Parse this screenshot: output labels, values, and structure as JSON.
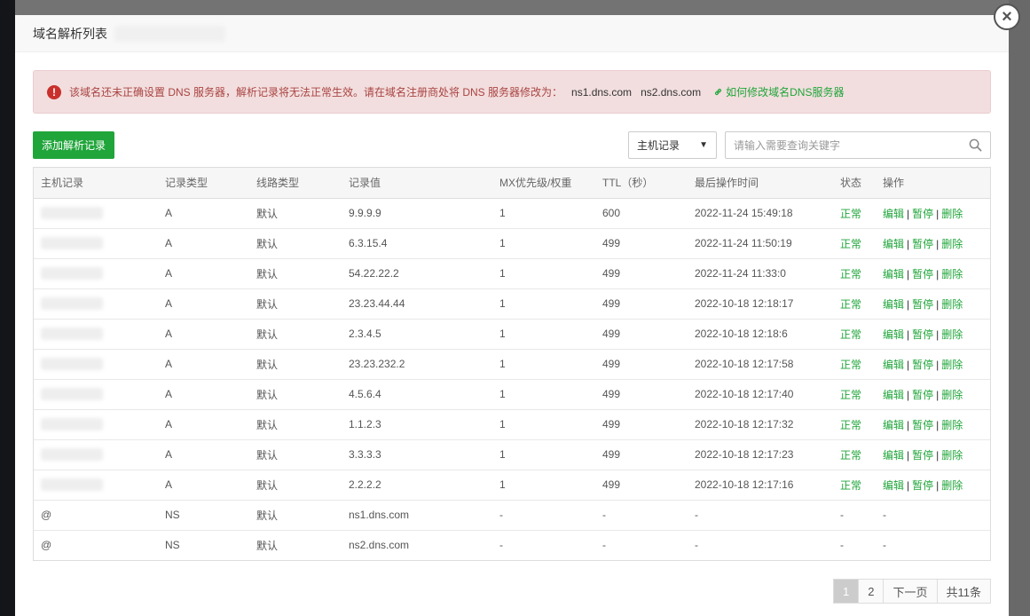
{
  "dialog": {
    "title": "域名解析列表"
  },
  "alert": {
    "message": "该域名还未正确设置 DNS 服务器，解析记录将无法正常生效。请在域名注册商处将 DNS 服务器修改为：",
    "ns1": "ns1.dns.com",
    "ns2": "ns2.dns.com",
    "link": "如何修改域名DNS服务器"
  },
  "toolbar": {
    "add_label": "添加解析记录",
    "select_value": "主机记录",
    "search_placeholder": "请输入需要查询关键字"
  },
  "table": {
    "headers": [
      "主机记录",
      "记录类型",
      "线路类型",
      "记录值",
      "MX优先级/权重",
      "TTL（秒）",
      "最后操作时间",
      "状态",
      "操作"
    ],
    "rows": [
      {
        "host": "",
        "type": "A",
        "line": "默认",
        "value": "9.9.9.9",
        "mx": "1",
        "ttl": "600",
        "time": "2022-11-24 15:49:18",
        "status": "正常",
        "edit": "编辑",
        "pause": "暂停",
        "del": "删除"
      },
      {
        "host": "",
        "type": "A",
        "line": "默认",
        "value": "6.3.15.4",
        "mx": "1",
        "ttl": "499",
        "time": "2022-11-24 11:50:19",
        "status": "正常",
        "edit": "编辑",
        "pause": "暂停",
        "del": "删除"
      },
      {
        "host": "",
        "type": "A",
        "line": "默认",
        "value": "54.22.22.2",
        "mx": "1",
        "ttl": "499",
        "time": "2022-11-24 11:33:0",
        "status": "正常",
        "edit": "编辑",
        "pause": "暂停",
        "del": "删除"
      },
      {
        "host": "",
        "type": "A",
        "line": "默认",
        "value": "23.23.44.44",
        "mx": "1",
        "ttl": "499",
        "time": "2022-10-18 12:18:17",
        "status": "正常",
        "edit": "编辑",
        "pause": "暂停",
        "del": "删除"
      },
      {
        "host": "",
        "type": "A",
        "line": "默认",
        "value": "2.3.4.5",
        "mx": "1",
        "ttl": "499",
        "time": "2022-10-18 12:18:6",
        "status": "正常",
        "edit": "编辑",
        "pause": "暂停",
        "del": "删除"
      },
      {
        "host": "",
        "type": "A",
        "line": "默认",
        "value": "23.23.232.2",
        "mx": "1",
        "ttl": "499",
        "time": "2022-10-18 12:17:58",
        "status": "正常",
        "edit": "编辑",
        "pause": "暂停",
        "del": "删除"
      },
      {
        "host": "",
        "type": "A",
        "line": "默认",
        "value": "4.5.6.4",
        "mx": "1",
        "ttl": "499",
        "time": "2022-10-18 12:17:40",
        "status": "正常",
        "edit": "编辑",
        "pause": "暂停",
        "del": "删除"
      },
      {
        "host": "",
        "type": "A",
        "line": "默认",
        "value": "1.1.2.3",
        "mx": "1",
        "ttl": "499",
        "time": "2022-10-18 12:17:32",
        "status": "正常",
        "edit": "编辑",
        "pause": "暂停",
        "del": "删除"
      },
      {
        "host": "",
        "type": "A",
        "line": "默认",
        "value": "3.3.3.3",
        "mx": "1",
        "ttl": "499",
        "time": "2022-10-18 12:17:23",
        "status": "正常",
        "edit": "编辑",
        "pause": "暂停",
        "del": "删除"
      },
      {
        "host": "",
        "type": "A",
        "line": "默认",
        "value": "2.2.2.2",
        "mx": "1",
        "ttl": "499",
        "time": "2022-10-18 12:17:16",
        "status": "正常",
        "edit": "编辑",
        "pause": "暂停",
        "del": "删除"
      },
      {
        "host": "@",
        "type": "NS",
        "line": "默认",
        "value": "ns1.dns.com",
        "mx": "-",
        "ttl": "-",
        "time": "-",
        "status": "-",
        "edit": "-",
        "pause": "",
        "del": ""
      },
      {
        "host": "@",
        "type": "NS",
        "line": "默认",
        "value": "ns2.dns.com",
        "mx": "-",
        "ttl": "-",
        "time": "-",
        "status": "-",
        "edit": "-",
        "pause": "",
        "del": ""
      }
    ]
  },
  "pager": {
    "page1": "1",
    "page2": "2",
    "next": "下一页",
    "total": "共11条"
  },
  "colors": {
    "accent": "#20a53a",
    "alert_bg": "#f2dede",
    "alert_text": "#a94442"
  }
}
